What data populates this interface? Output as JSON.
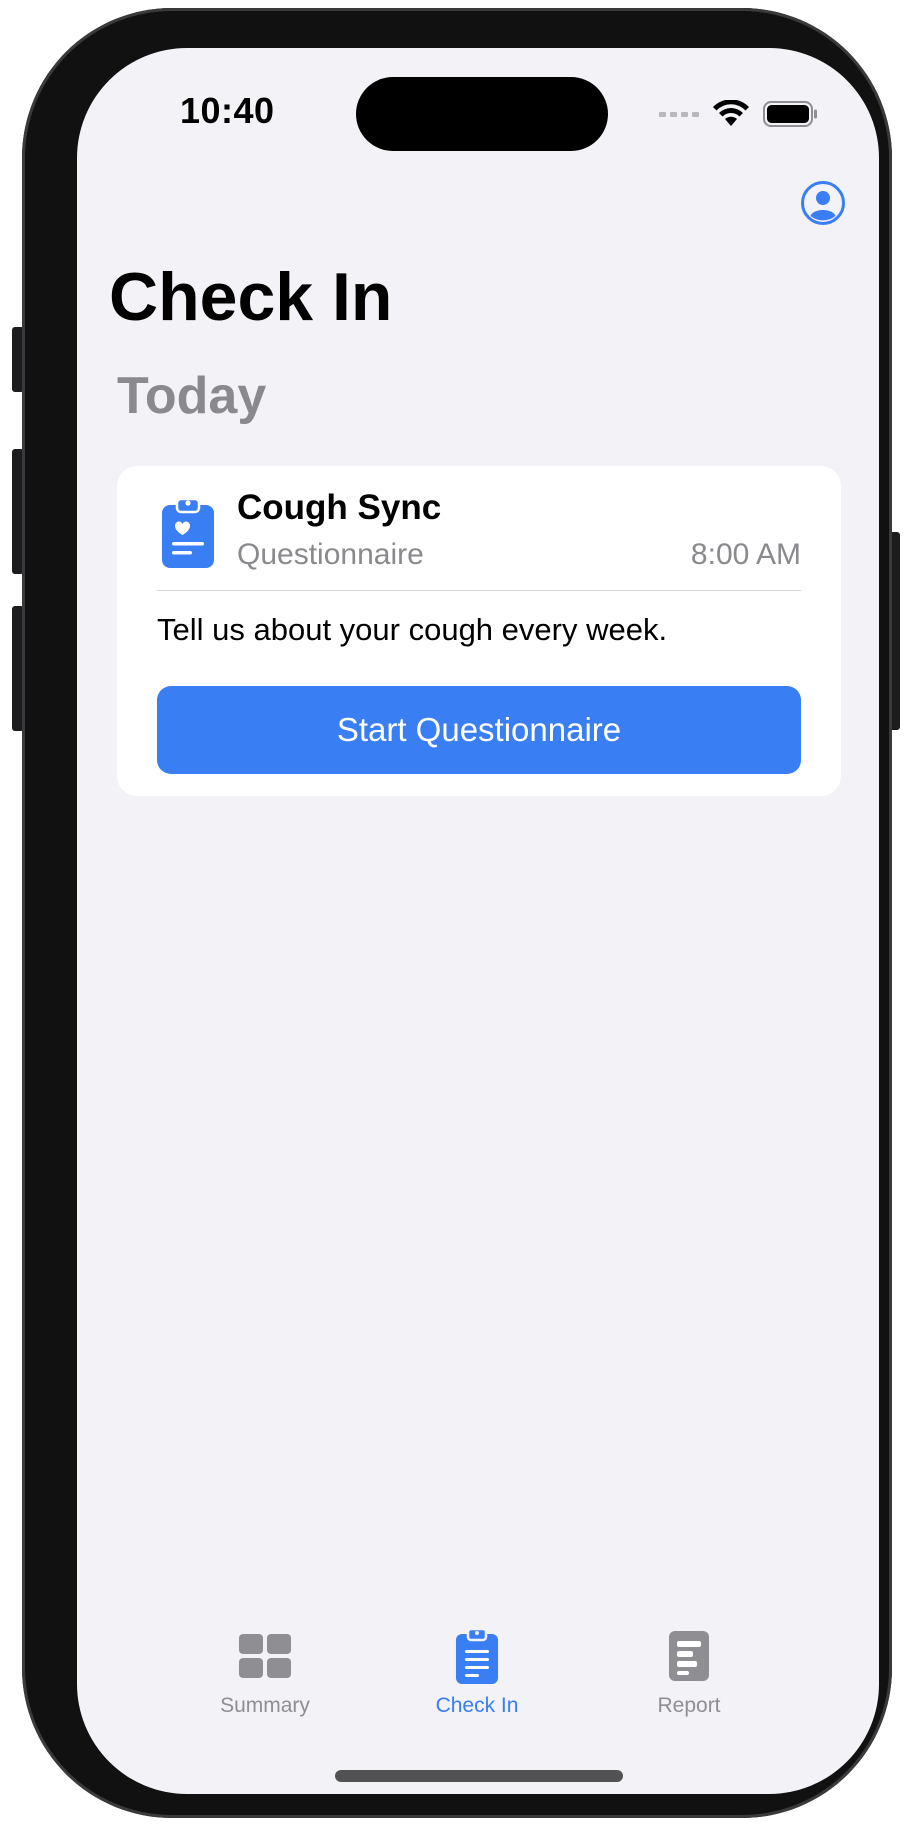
{
  "status_bar": {
    "time": "10:40"
  },
  "header": {
    "title": "Check In",
    "profile_icon": "person-crop-circle-icon"
  },
  "section": {
    "title": "Today"
  },
  "card": {
    "icon": "clipboard-heart-icon",
    "title": "Cough Sync",
    "subtitle": "Questionnaire",
    "time": "8:00 AM",
    "description": "Tell us about your cough every week.",
    "button_label": "Start Questionnaire"
  },
  "tabbar": {
    "tabs": [
      {
        "label": "Summary",
        "icon": "grid-icon",
        "selected": false
      },
      {
        "label": "Check In",
        "icon": "clipboard-icon",
        "selected": true
      },
      {
        "label": "Report",
        "icon": "document-icon",
        "selected": false
      }
    ]
  },
  "colors": {
    "accent": "#3a7ef3",
    "secondary_text": "#8a8a8e",
    "background": "#f2f2f7",
    "inactive_tab": "#8e8e93"
  }
}
